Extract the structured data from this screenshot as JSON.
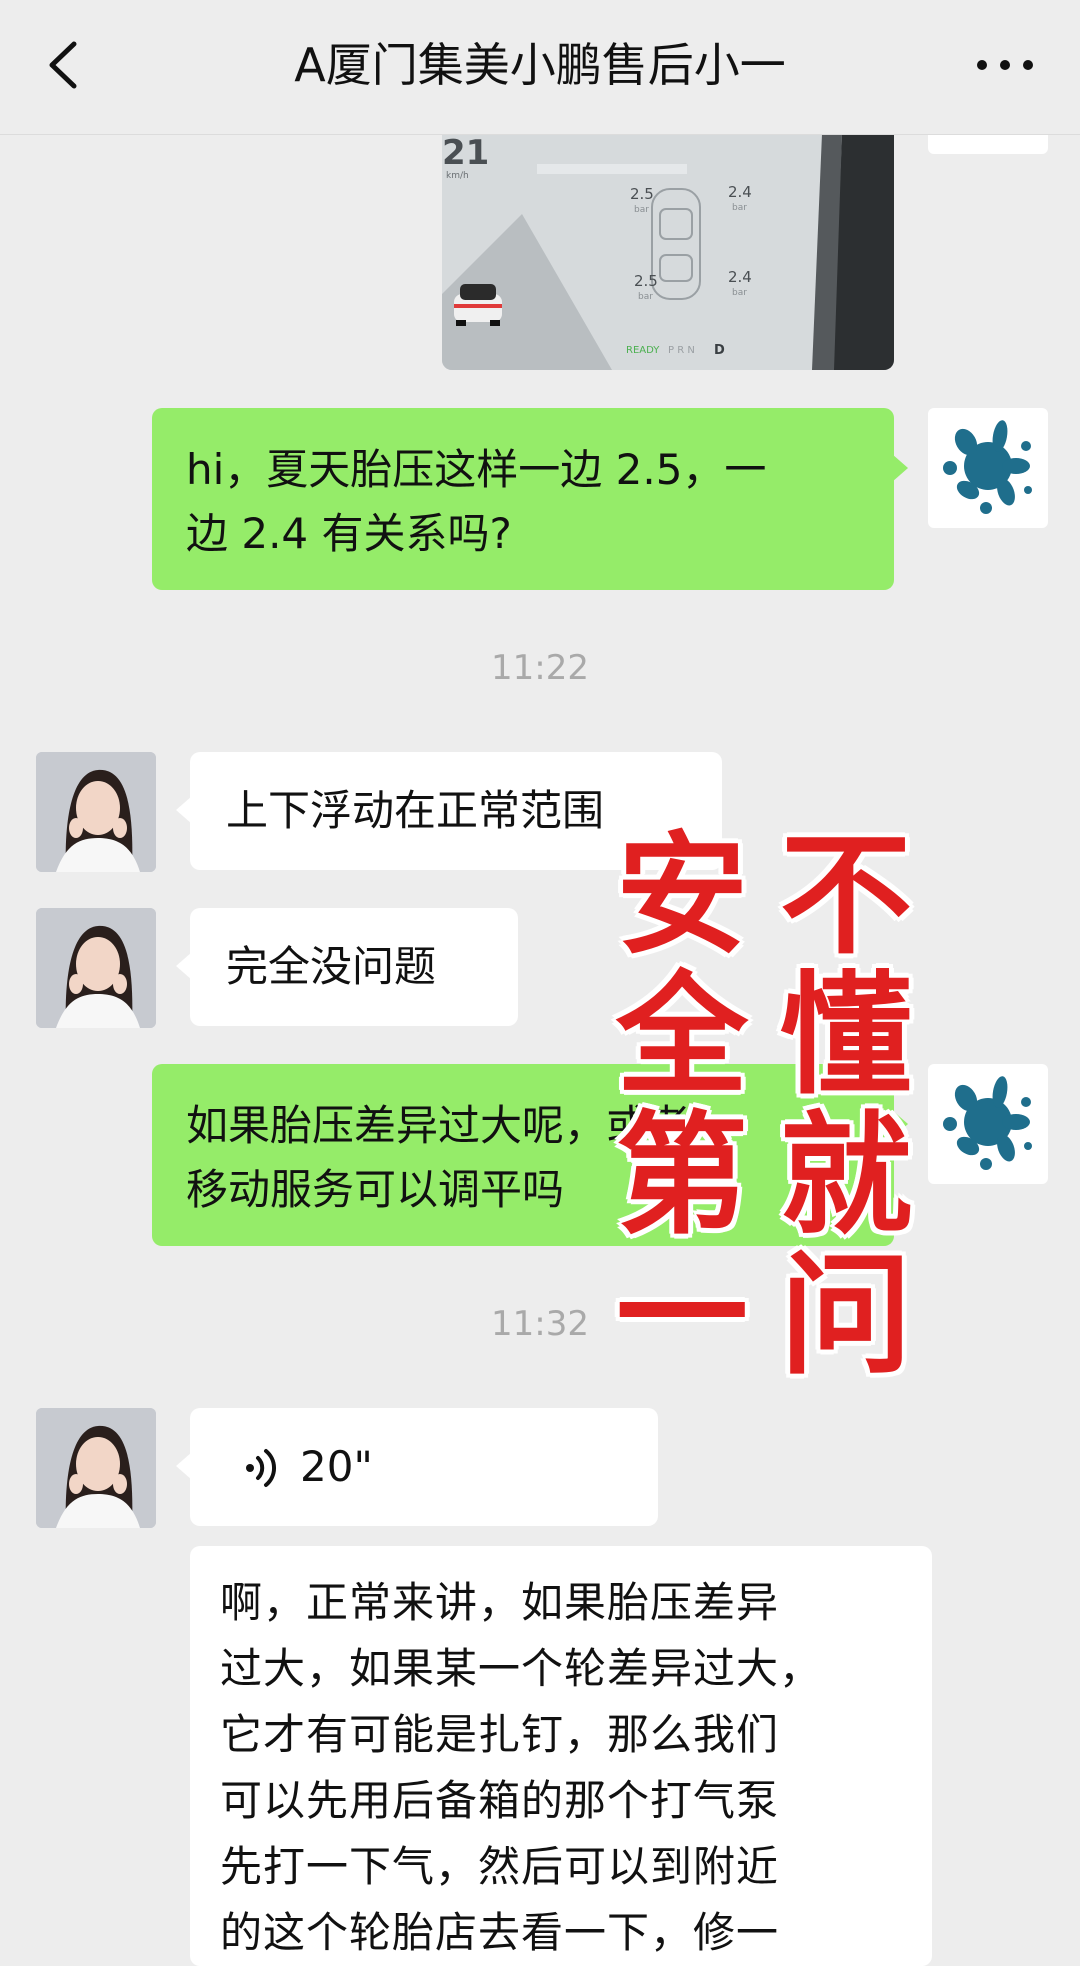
{
  "header": {
    "title": "A厦门集美小鹏售后小一",
    "back_icon": "back-chevron-icon",
    "more_icon": "more-dots-icon"
  },
  "photo": {
    "speed": "21",
    "speed_unit": "km/h",
    "tire_front_left": "2.5",
    "tire_front_right": "2.4",
    "tire_rear_left": "2.5",
    "tire_rear_right": "2.4",
    "tire_unit": "bar",
    "gear_ready": "READY",
    "gear_letters": "P R N",
    "gear_active": "D"
  },
  "messages": {
    "m1": "hi，夏天胎压这样一边 2.5，一\n边 2.4 有关系吗?",
    "t1": "11:22",
    "m2": "上下浮动在正常范围",
    "m3": "完全没问题",
    "m4": "如果胎压差异过大呢，或者\n移动服务可以调平吗",
    "t2": "11:32",
    "voice_duration": "20\"",
    "m6": "啊，正常来讲，如果胎压差异\n过大，如果某一个轮差异过大，\n它才有可能是扎钉，那么我们\n可以先用后备箱的那个打气泵\n先打一下气，然后可以到附近\n的这个轮胎店去看一下，修一"
  },
  "overlay": {
    "col_left": [
      "安",
      "全",
      "第",
      "一"
    ],
    "col_right": [
      "不",
      "懂",
      "就",
      "问"
    ]
  },
  "colors": {
    "self_bubble": "#95ec69",
    "other_bubble": "#ffffff",
    "background": "#ededed",
    "overlay_text": "#e02020",
    "self_avatar_splash": "#1f6e8c"
  }
}
